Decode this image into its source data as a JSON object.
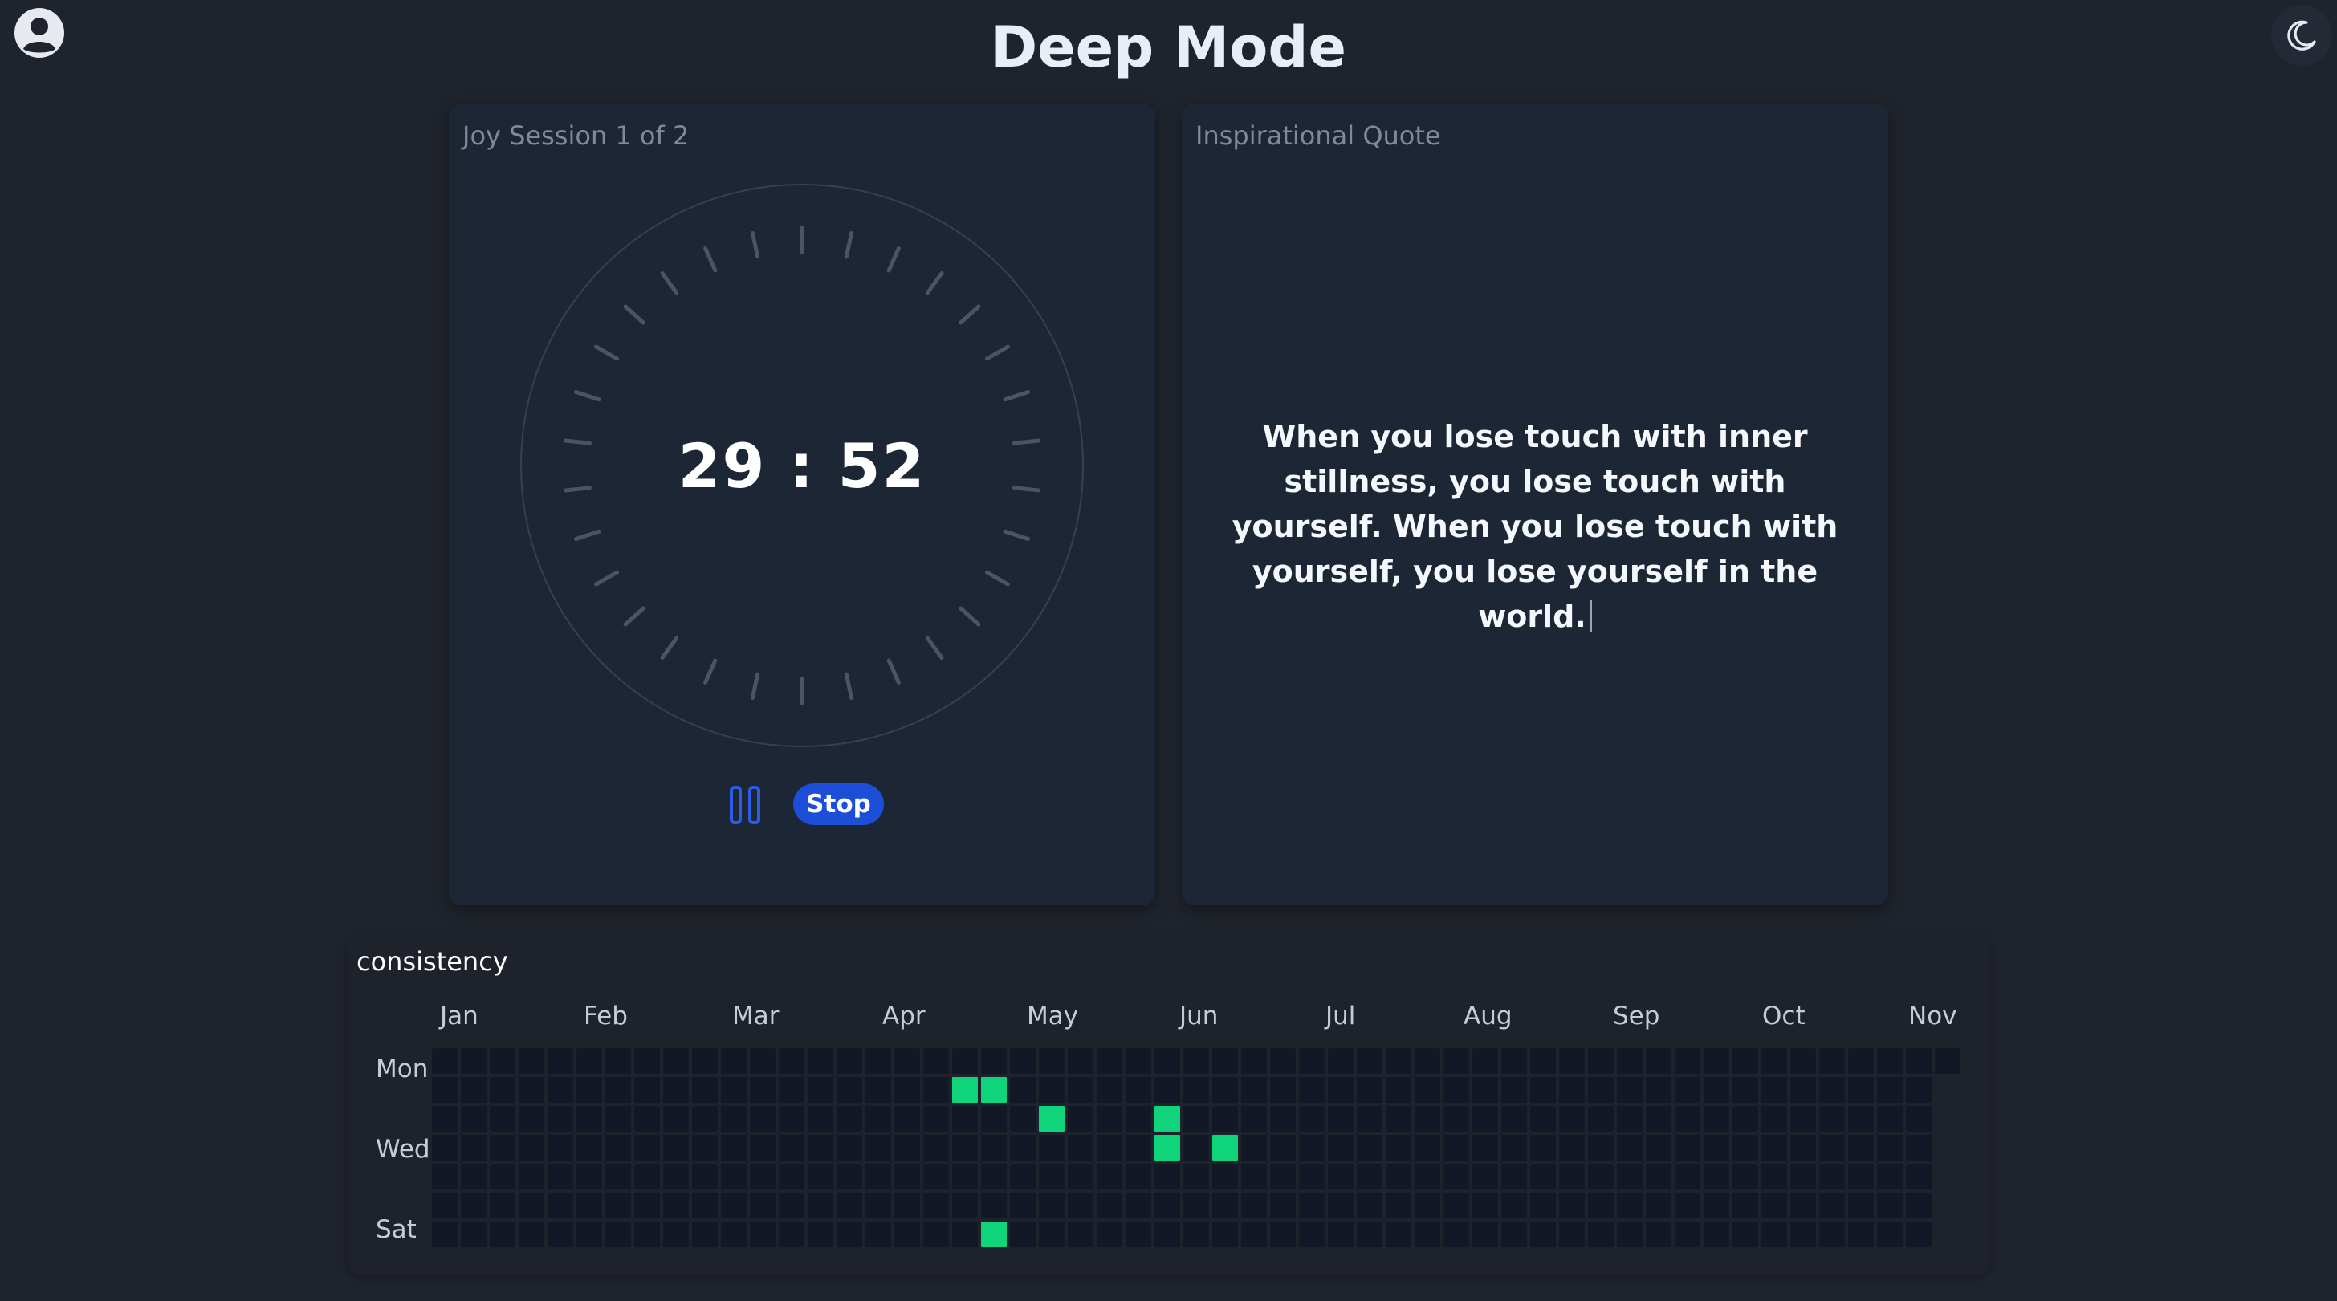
{
  "header": {
    "title": "Deep Mode",
    "profile_icon": "user-circle-icon",
    "theme_icon": "moon-icon"
  },
  "timer": {
    "session_label": "Joy Session 1 of 2",
    "time_display": "29 : 52",
    "pause_icon": "pause-icon",
    "stop_label": "Stop"
  },
  "quote": {
    "label": "Inspirational Quote",
    "text": "When you lose touch with inner stillness, you lose touch with yourself. When you lose touch with yourself, you lose yourself in the world."
  },
  "consistency": {
    "title": "consistency",
    "months": [
      "Jan",
      "Feb",
      "Mar",
      "Apr",
      "May",
      "Jun",
      "Jul",
      "Aug",
      "Sep",
      "Oct",
      "Nov"
    ],
    "day_labels": [
      "Mon",
      "Wed",
      "Sat"
    ],
    "weeks": 53,
    "days_per_week": 7,
    "first_week_start_row": 0,
    "last_week_rows": 1,
    "active_cells": [
      {
        "week": 18,
        "day": 2
      },
      {
        "week": 19,
        "day": 2
      },
      {
        "week": 21,
        "day": 3
      },
      {
        "week": 25,
        "day": 3
      },
      {
        "week": 25,
        "day": 4
      },
      {
        "week": 27,
        "day": 4
      },
      {
        "week": 19,
        "day": 7
      }
    ],
    "colors": {
      "empty": "#121825",
      "active": "#10d47a"
    }
  },
  "colors": {
    "background": "#1f232b",
    "card": "#1c2634",
    "accent": "#1d4ed8"
  }
}
